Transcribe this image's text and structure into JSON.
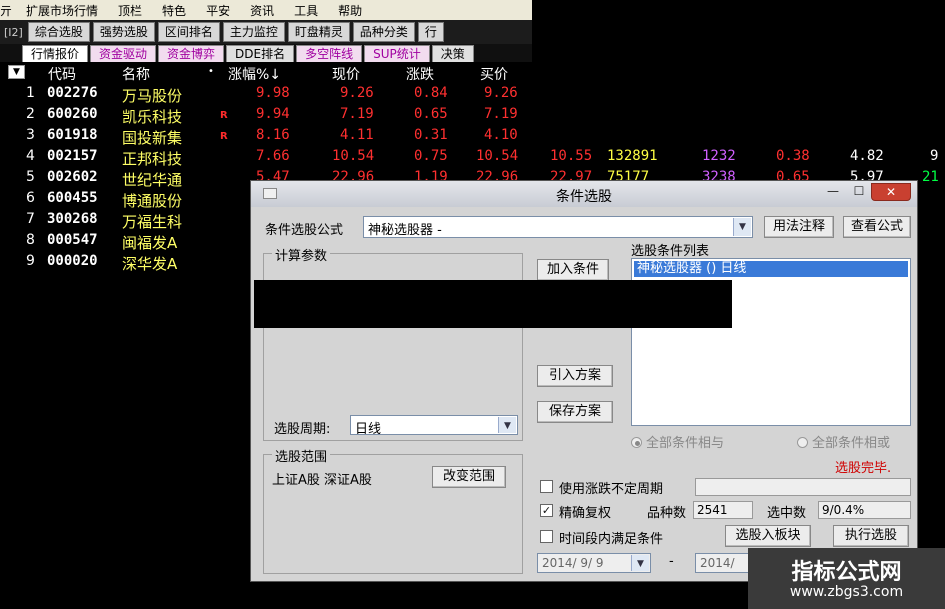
{
  "menu": [
    "扩展市场行情",
    "顶栏",
    "特色",
    "平安",
    "资讯",
    "工具",
    "帮助"
  ],
  "menu_lead": "亓",
  "toolbar": {
    "tag": "[I2]",
    "buttons": [
      "综合选股",
      "强势选股",
      "区间排名",
      "主力监控",
      "盯盘精灵",
      "品种分类",
      "行"
    ]
  },
  "tabs": [
    "行情报价",
    "资金驱动",
    "资金博弈",
    "DDE排名",
    "多空阵线",
    "SUP统计",
    "决策"
  ],
  "columns": {
    "code": "代码",
    "name": "名称",
    "dot": "•",
    "change_pct": "涨幅%↓",
    "price": "现价",
    "change": "涨跌",
    "bid": "买价"
  },
  "sort_icon": "▼",
  "rows": [
    {
      "idx": "1",
      "code": "002276",
      "name": "万马股份",
      "flag": "",
      "pct": "9.98",
      "price": "9.26",
      "chg": "0.84",
      "bid": "9.26"
    },
    {
      "idx": "2",
      "code": "600260",
      "name": "凯乐科技",
      "flag": "R",
      "pct": "9.94",
      "price": "7.19",
      "chg": "0.65",
      "bid": "7.19"
    },
    {
      "idx": "3",
      "code": "601918",
      "name": "国投新集",
      "flag": "R",
      "pct": "8.16",
      "price": "4.11",
      "chg": "0.31",
      "bid": "4.10"
    },
    {
      "idx": "4",
      "code": "002157",
      "name": "正邦科技",
      "flag": "",
      "pct": "7.66",
      "price": "10.54",
      "chg": "0.75",
      "bid": "10.54",
      "ask": "10.55",
      "vol": "132891",
      "cur": "1232",
      "x1": "0.38",
      "x2": "4.82",
      "x3": "9"
    },
    {
      "idx": "5",
      "code": "002602",
      "name": "世纪华通",
      "flag": "",
      "pct": "5.47",
      "price": "22.96",
      "chg": "1.19",
      "bid": "22.96",
      "ask": "22.97",
      "vol": "75177",
      "cur": "3238",
      "x1": "0.65",
      "x2": "5.97",
      "x3": "21"
    },
    {
      "idx": "6",
      "code": "600455",
      "name": "博通股份",
      "flag": ""
    },
    {
      "idx": "7",
      "code": "300268",
      "name": "万福生科",
      "flag": ""
    },
    {
      "idx": "8",
      "code": "000547",
      "name": "闽福发A",
      "flag": ""
    },
    {
      "idx": "9",
      "code": "000020",
      "name": "深华发A",
      "flag": ""
    }
  ],
  "dialog": {
    "title": "条件选股",
    "win_min": "—",
    "win_max": "☐",
    "win_close": "✕",
    "formula_label": "条件选股公式",
    "formula_value": "神秘选股器 -",
    "usage_btn": "用法注释",
    "view_btn": "查看公式",
    "params_group": "计算参数",
    "add_cond_btn": "加入条件",
    "cond_list_label": "选股条件列表",
    "cond_list_items": [
      "神秘选股器 () 日线"
    ],
    "import_btn": "引入方案",
    "save_btn": "保存方案",
    "period_label": "选股周期:",
    "period_value": "日线",
    "radio_and": "全部条件相与",
    "radio_or": "全部条件相或",
    "status": "选股完毕.",
    "scope_group": "选股范围",
    "scope_value": "上证A股 深证A股",
    "change_scope_btn": "改变范围",
    "use_indef_period": "使用涨跌不定周期",
    "adjust_label": "精确复权",
    "count_label": "品种数",
    "count_value": "2541",
    "selected_label": "选中数",
    "selected_value": "9/0.4%",
    "time_cond_label": "时间段内满足条件",
    "to_block_btn": "选股入板块",
    "run_btn": "执行选股",
    "date_from": "2014/ 9/ 9",
    "date_sep": "-",
    "date_to": "2014/"
  },
  "watermark": {
    "line1": "指标公式网",
    "line2": "www.zbgs3.com"
  },
  "colors": {
    "rise": "#ff3030",
    "name": "#ffff66",
    "background": "#000000",
    "dialog": "#d4d4d4",
    "selection": "#3a7ad8"
  }
}
